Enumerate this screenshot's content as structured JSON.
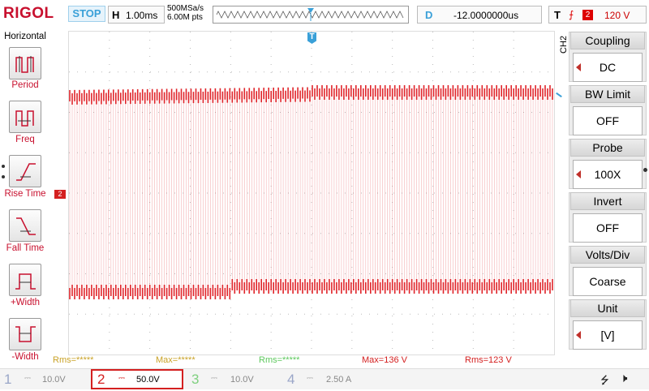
{
  "brand": "RIGOL",
  "status": "STOP",
  "horizontal": {
    "key": "H",
    "timebase": "1.00ms",
    "sample_rate": "500MSa/s",
    "points": "6.00M pts"
  },
  "delay": {
    "key": "D",
    "value": "-12.0000000us"
  },
  "trigger": {
    "key": "T",
    "source": "2",
    "level": "120 V"
  },
  "trigger_marker": "T",
  "left_menu": {
    "title": "Horizontal",
    "items": [
      {
        "label": "Period",
        "icon": "period-icon"
      },
      {
        "label": "Freq",
        "icon": "frequency-icon"
      },
      {
        "label": "Rise Time",
        "icon": "rise-time-icon"
      },
      {
        "label": "Fall Time",
        "icon": "fall-time-icon"
      },
      {
        "label": "+Width",
        "icon": "positive-width-icon"
      },
      {
        "label": "-Width",
        "icon": "negative-width-icon"
      }
    ]
  },
  "channel_marker": "2",
  "right_menu": {
    "channel": "CH2",
    "items": [
      {
        "title": "Coupling",
        "value": "DC"
      },
      {
        "title": "BW Limit",
        "value": "OFF"
      },
      {
        "title": "Probe",
        "value": "100X"
      },
      {
        "title": "Invert",
        "value": "OFF"
      },
      {
        "title": "Volts/Div",
        "value": "Coarse"
      },
      {
        "title": "Unit",
        "value": "[V]"
      }
    ]
  },
  "measurements": [
    {
      "text": "Rms=*****",
      "color": "#c9a227"
    },
    {
      "text": "Max=*****",
      "color": "#c9a227"
    },
    {
      "text": "Rms=*****",
      "color": "#5cc85c"
    },
    {
      "text": "Max=136 V",
      "color": "#d42020"
    },
    {
      "text": "Rms=123 V",
      "color": "#d42020"
    }
  ],
  "channels": [
    {
      "num": "1",
      "scale": "10.0V",
      "color": "#9aa6c8",
      "active": false
    },
    {
      "num": "2",
      "scale": "50.0V",
      "color": "#d42020",
      "active": true
    },
    {
      "num": "3",
      "scale": "10.0V",
      "color": "#7fd07f",
      "active": false
    },
    {
      "num": "4",
      "scale": "2.50 A",
      "color": "#9aa6c8",
      "active": false
    }
  ],
  "status_icons": [
    "usb-icon",
    "speaker-icon"
  ],
  "colors": {
    "trace": "#e0242a",
    "accent": "#3aa0d8",
    "brand": "#c8102e"
  }
}
